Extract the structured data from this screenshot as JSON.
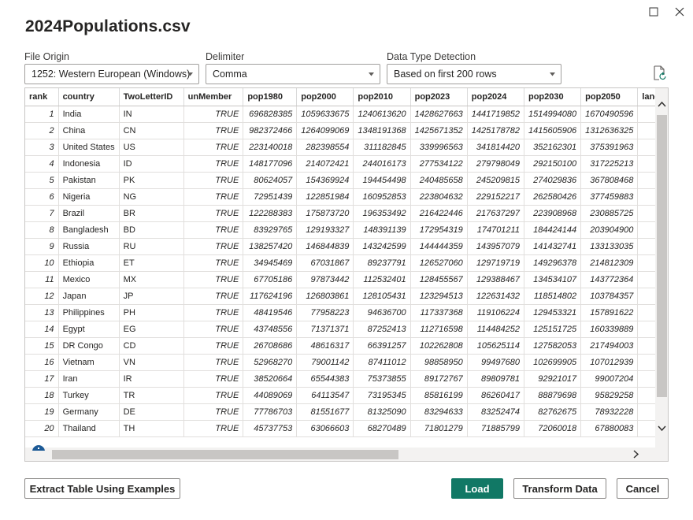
{
  "dialog": {
    "title": "2024Populations.csv"
  },
  "options": {
    "file_origin": {
      "label": "File Origin",
      "value": "1252: Western European (Windows)"
    },
    "delimiter": {
      "label": "Delimiter",
      "value": "Comma"
    },
    "data_type_detection": {
      "label": "Data Type Detection",
      "value": "Based on first 200 rows"
    }
  },
  "icons": {
    "maximize": "maximize-icon",
    "close": "close-icon",
    "refresh": "refresh-document-icon",
    "info": "info-icon"
  },
  "colors": {
    "primary_button": "#117865",
    "border": "#c8c6c4"
  },
  "table": {
    "columns": [
      "rank",
      "country",
      "TwoLetterID",
      "unMember",
      "pop1980",
      "pop2000",
      "pop2010",
      "pop2023",
      "pop2024",
      "pop2030",
      "pop2050",
      "land"
    ],
    "rows": [
      [
        "1",
        "India",
        "IN",
        "TRUE",
        "696828385",
        "1059633675",
        "1240613620",
        "1428627663",
        "1441719852",
        "1514994080",
        "1670490596"
      ],
      [
        "2",
        "China",
        "CN",
        "TRUE",
        "982372466",
        "1264099069",
        "1348191368",
        "1425671352",
        "1425178782",
        "1415605906",
        "1312636325"
      ],
      [
        "3",
        "United States",
        "US",
        "TRUE",
        "223140018",
        "282398554",
        "311182845",
        "339996563",
        "341814420",
        "352162301",
        "375391963"
      ],
      [
        "4",
        "Indonesia",
        "ID",
        "TRUE",
        "148177096",
        "214072421",
        "244016173",
        "277534122",
        "279798049",
        "292150100",
        "317225213"
      ],
      [
        "5",
        "Pakistan",
        "PK",
        "TRUE",
        "80624057",
        "154369924",
        "194454498",
        "240485658",
        "245209815",
        "274029836",
        "367808468"
      ],
      [
        "6",
        "Nigeria",
        "NG",
        "TRUE",
        "72951439",
        "122851984",
        "160952853",
        "223804632",
        "229152217",
        "262580426",
        "377459883"
      ],
      [
        "7",
        "Brazil",
        "BR",
        "TRUE",
        "122288383",
        "175873720",
        "196353492",
        "216422446",
        "217637297",
        "223908968",
        "230885725"
      ],
      [
        "8",
        "Bangladesh",
        "BD",
        "TRUE",
        "83929765",
        "129193327",
        "148391139",
        "172954319",
        "174701211",
        "184424144",
        "203904900"
      ],
      [
        "9",
        "Russia",
        "RU",
        "TRUE",
        "138257420",
        "146844839",
        "143242599",
        "144444359",
        "143957079",
        "141432741",
        "133133035"
      ],
      [
        "10",
        "Ethiopia",
        "ET",
        "TRUE",
        "34945469",
        "67031867",
        "89237791",
        "126527060",
        "129719719",
        "149296378",
        "214812309"
      ],
      [
        "11",
        "Mexico",
        "MX",
        "TRUE",
        "67705186",
        "97873442",
        "112532401",
        "128455567",
        "129388467",
        "134534107",
        "143772364"
      ],
      [
        "12",
        "Japan",
        "JP",
        "TRUE",
        "117624196",
        "126803861",
        "128105431",
        "123294513",
        "122631432",
        "118514802",
        "103784357"
      ],
      [
        "13",
        "Philippines",
        "PH",
        "TRUE",
        "48419546",
        "77958223",
        "94636700",
        "117337368",
        "119106224",
        "129453321",
        "157891622"
      ],
      [
        "14",
        "Egypt",
        "EG",
        "TRUE",
        "43748556",
        "71371371",
        "87252413",
        "112716598",
        "114484252",
        "125151725",
        "160339889"
      ],
      [
        "15",
        "DR Congo",
        "CD",
        "TRUE",
        "26708686",
        "48616317",
        "66391257",
        "102262808",
        "105625114",
        "127582053",
        "217494003"
      ],
      [
        "16",
        "Vietnam",
        "VN",
        "TRUE",
        "52968270",
        "79001142",
        "87411012",
        "98858950",
        "99497680",
        "102699905",
        "107012939"
      ],
      [
        "17",
        "Iran",
        "IR",
        "TRUE",
        "38520664",
        "65544383",
        "75373855",
        "89172767",
        "89809781",
        "92921017",
        "99007204"
      ],
      [
        "18",
        "Turkey",
        "TR",
        "TRUE",
        "44089069",
        "64113547",
        "73195345",
        "85816199",
        "86260417",
        "88879698",
        "95829258"
      ],
      [
        "19",
        "Germany",
        "DE",
        "TRUE",
        "77786703",
        "81551677",
        "81325090",
        "83294633",
        "83252474",
        "82762675",
        "78932228"
      ],
      [
        "20",
        "Thailand",
        "TH",
        "TRUE",
        "45737753",
        "63066603",
        "68270489",
        "71801279",
        "71885799",
        "72060018",
        "67880083"
      ]
    ]
  },
  "buttons": {
    "extract": "Extract Table Using Examples",
    "load": "Load",
    "transform": "Transform Data",
    "cancel": "Cancel"
  }
}
